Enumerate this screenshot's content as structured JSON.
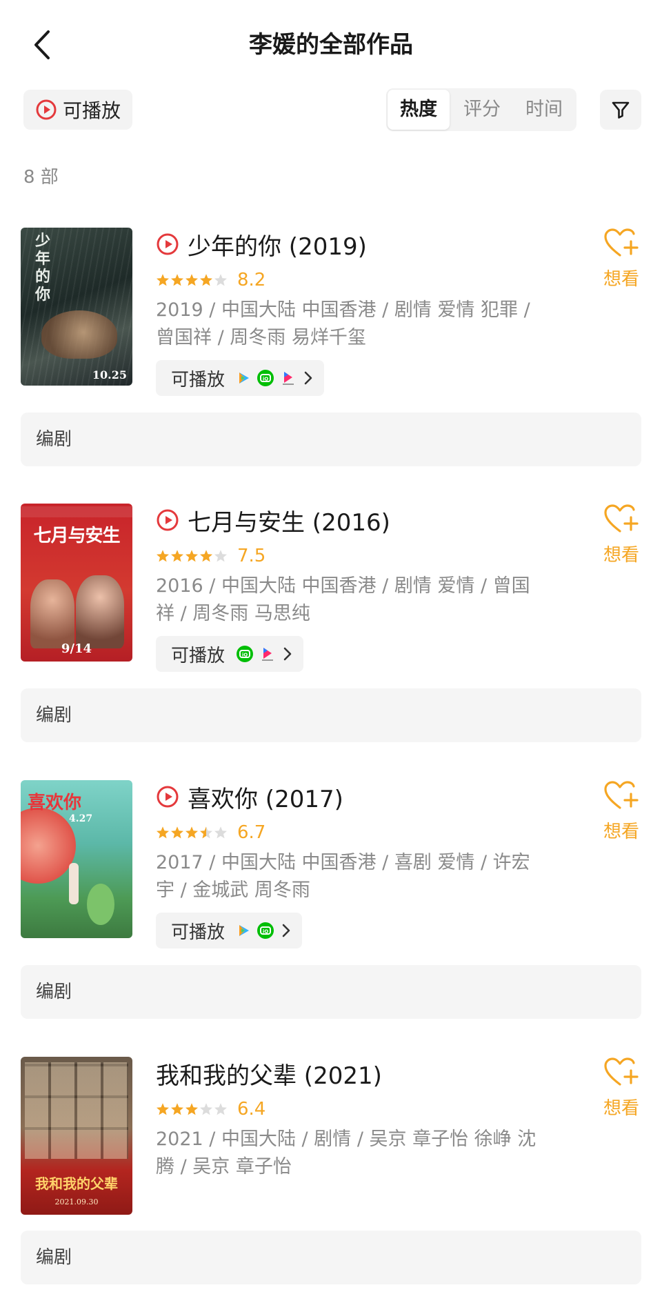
{
  "header": {
    "title": "李媛的全部作品"
  },
  "toolbar": {
    "playable_label": "可播放",
    "sort_tabs": [
      "热度",
      "评分",
      "时间"
    ],
    "active_sort": "热度"
  },
  "count": "8 部",
  "movies": [
    {
      "title": "少年的你 (2019)",
      "rating": 8.2,
      "stars": 4,
      "score": "8.2",
      "info": "2019 / 中国大陆 中国香港 / 剧情 爱情 犯罪 / 曾国祥 / 周冬雨 易烊千玺",
      "playable": true,
      "playable_label": "可播放",
      "services": [
        "tencent-video-icon",
        "iqiyi-icon",
        "youku-icon"
      ],
      "poster_text": "少年的你",
      "poster_date": "10.25",
      "want_label": "想看",
      "role": "编剧"
    },
    {
      "title": "七月与安生 (2016)",
      "rating": 7.5,
      "stars": 4,
      "score": "7.5",
      "info": "2016 / 中国大陆 中国香港 / 剧情 爱情 / 曾国祥 / 周冬雨 马思纯",
      "playable": true,
      "playable_label": "可播放",
      "services": [
        "iqiyi-icon",
        "youku-icon"
      ],
      "poster_text": "七月与安生",
      "poster_date": "9/14",
      "want_label": "想看",
      "role": "编剧"
    },
    {
      "title": "喜欢你 (2017)",
      "rating": 6.7,
      "stars": 3.5,
      "score": "6.7",
      "info": "2017 / 中国大陆 中国香港 / 喜剧 爱情 / 许宏宇 / 金城武 周冬雨",
      "playable": true,
      "playable_label": "可播放",
      "services": [
        "tencent-video-icon",
        "iqiyi-icon"
      ],
      "poster_text": "喜欢你",
      "poster_date": "4.27",
      "want_label": "想看",
      "role": "编剧"
    },
    {
      "title": "我和我的父辈 (2021)",
      "rating": 6.4,
      "stars": 3,
      "score": "6.4",
      "info": "2021 / 中国大陆 / 剧情 / 吴京 章子怡 徐峥 沈腾 / 吴京 章子怡",
      "playable": false,
      "poster_text": "我和我的父辈",
      "poster_date": "2021.09.30",
      "want_label": "想看",
      "role": "编剧"
    }
  ],
  "colors": {
    "accent_orange": "#f5a623",
    "play_red": "#e4393c",
    "chip_bg": "#f3f3f3",
    "text_gray": "#8a8a8a"
  }
}
